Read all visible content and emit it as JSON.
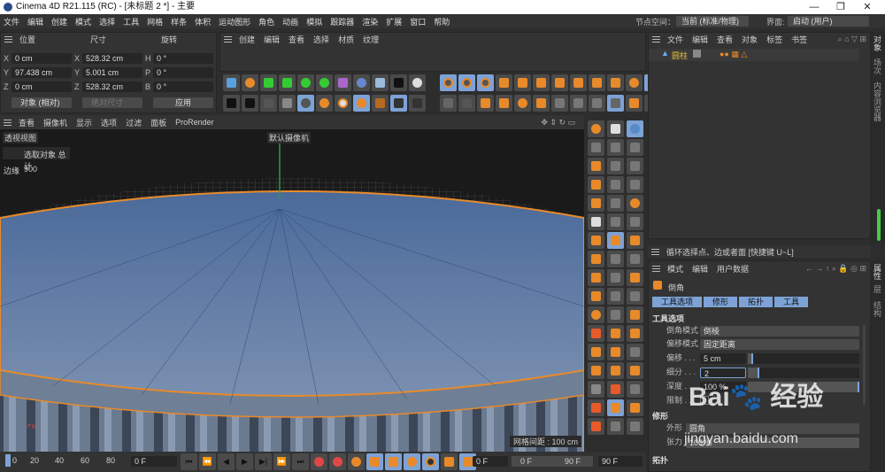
{
  "window": {
    "title": "Cinema 4D R21.115 (RC) - [未标题 2 *] - 主要",
    "min": "—",
    "max": "❐",
    "close": "✕"
  },
  "menu": [
    "文件",
    "编辑",
    "创建",
    "模式",
    "选择",
    "工具",
    "网格",
    "样条",
    "体积",
    "运动图形",
    "角色",
    "动画",
    "模拟",
    "跟踪器",
    "渲染",
    "扩展",
    "窗口",
    "帮助"
  ],
  "nodespace": {
    "label": "节点空间：",
    "value": "当前 (标准/物理)"
  },
  "layout": {
    "label": "界面:",
    "value": "启动 (用户)"
  },
  "coords": {
    "headers": [
      "位置",
      "尺寸",
      "旋转"
    ],
    "position": [
      {
        "axis": "X",
        "value": "0 cm"
      },
      {
        "axis": "Y",
        "value": "97.438 cm"
      },
      {
        "axis": "Z",
        "value": "0 cm"
      }
    ],
    "size": [
      {
        "axis": "X",
        "value": "528.32 cm"
      },
      {
        "axis": "Y",
        "value": "5.001 cm"
      },
      {
        "axis": "Z",
        "value": "528.32 cm"
      }
    ],
    "rotation": [
      {
        "axis": "H",
        "value": "0 °"
      },
      {
        "axis": "P",
        "value": "0 °"
      },
      {
        "axis": "B",
        "value": "0 °"
      }
    ],
    "mode": "对象 (相对)",
    "size_mode": "绝对尺寸",
    "apply": "应用"
  },
  "material_menu": [
    "创建",
    "编辑",
    "查看",
    "选择",
    "材质",
    "纹理"
  ],
  "object_manager": {
    "menu": [
      "文件",
      "编辑",
      "查看",
      "对象",
      "标签",
      "书签"
    ],
    "object": "圆柱"
  },
  "right_tabs": [
    "对象",
    "场次",
    "内容浏览器"
  ],
  "attr_tabs_side": [
    "属性",
    "层",
    "结构"
  ],
  "viewport": {
    "menu": [
      "查看",
      "摄像机",
      "显示",
      "选项",
      "过滤",
      "面板",
      "ProRender"
    ],
    "view_name": "透视视图",
    "camera": "默认摄像机",
    "stats_title": "选取对象 总计",
    "stats_label": "边缘",
    "stats_value": "900",
    "grid": "网格间距 : 100 cm"
  },
  "hint": "循环选择点、边或者面 [快捷键 U~L]",
  "attributes": {
    "menu": [
      "模式",
      "编辑",
      "用户数据"
    ],
    "tool": "倒角",
    "tabs": [
      "工具选项",
      "修形",
      "拓扑",
      "工具"
    ],
    "section1": "工具选项",
    "bevel_mode": {
      "label": "倒角模式",
      "value": "倒棱"
    },
    "offset_mode": {
      "label": "偏移模式",
      "value": "固定距离"
    },
    "offset": {
      "label": "偏移 . . .",
      "value": "5 cm",
      "fraction": 0.05
    },
    "subdivision": {
      "label": "细分 . . .",
      "value": "2",
      "fraction": 0.1
    },
    "depth": {
      "label": "深度 . . .",
      "value": "100 %",
      "fraction": 1.0
    },
    "limit": {
      "label": "限制 . . ."
    },
    "section2": "修形",
    "shape": {
      "label": "外形",
      "value": "圆角"
    },
    "tension": {
      "label": "张力",
      "value": "100 %"
    },
    "section3": "拓扑"
  },
  "timeline": {
    "ticks": [
      "0",
      "20",
      "40",
      "60",
      "80"
    ],
    "current": "0 F",
    "frame_field": "0 F",
    "range_start": "0 F",
    "range_end": "90 F",
    "end": "90 F"
  },
  "watermark": {
    "brand": "Bai du 经验",
    "url": "jingyan.baidu.com"
  }
}
